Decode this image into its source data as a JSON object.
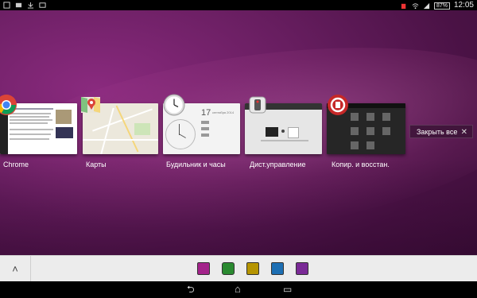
{
  "statusbar": {
    "battery": "87%",
    "time": "12:05",
    "left_icons": [
      "screenshot-icon",
      "image-icon",
      "download-icon",
      "notification-icon"
    ],
    "right_icons": [
      "battery-icon",
      "wifi-icon",
      "signal-icon"
    ]
  },
  "recents": [
    {
      "label": "Chrome",
      "icon": "chrome-icon"
    },
    {
      "label": "Карты",
      "icon": "maps-icon"
    },
    {
      "label": "Будильник и часы",
      "icon": "clock-icon",
      "date": "17",
      "month": "сентября 2014"
    },
    {
      "label": "Дист.управление",
      "icon": "remote-icon"
    },
    {
      "label": "Копир. и восстан.",
      "icon": "backup-icon"
    }
  ],
  "close_all": {
    "label": "Закрыть все",
    "x": "✕"
  },
  "dock": {
    "up": "˄"
  },
  "navbar": {
    "back": "⮌",
    "home": "⌂",
    "recents": "▭"
  },
  "colors": {
    "accent": "#6b1f63",
    "dock_bg": "#ececec"
  }
}
